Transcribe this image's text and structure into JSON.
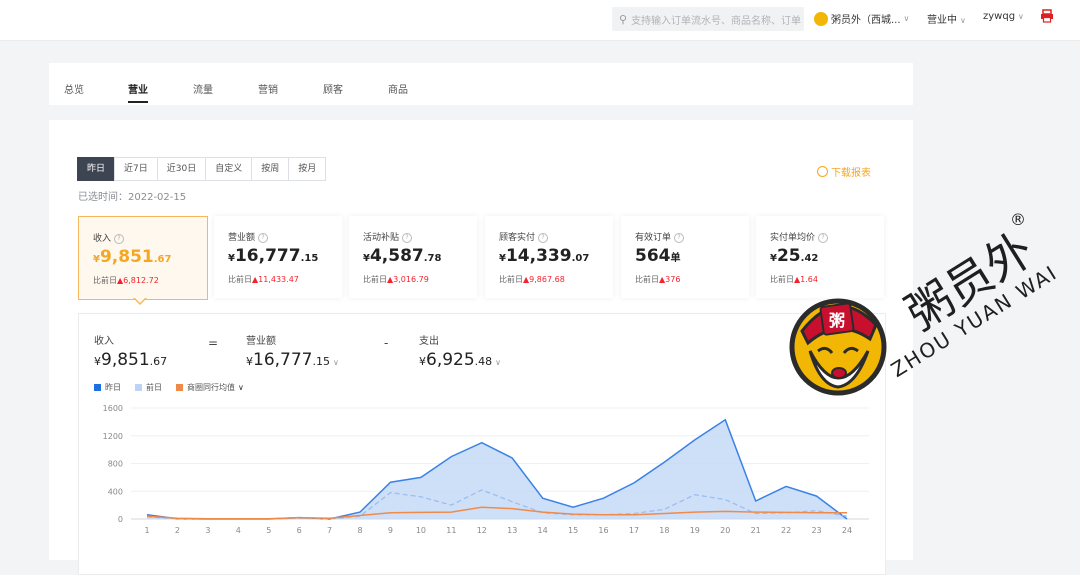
{
  "header": {
    "search_placeholder": "支持输入订单流水号、商品名称、订单",
    "store_name": "粥员外（西城...",
    "status": "营业中",
    "user": "zywqg"
  },
  "tabs": [
    "总览",
    "营业",
    "流量",
    "营销",
    "顾客",
    "商品"
  ],
  "active_tab": "营业",
  "date_ranges": [
    "昨日",
    "近7日",
    "近30日",
    "自定义",
    "按周",
    "按月"
  ],
  "active_range": "昨日",
  "selected_time": "已选时间：2022-02-15",
  "download_label": "下载报表",
  "kpis": [
    {
      "label": "收入",
      "currency": "¥",
      "int": "9,851",
      "dec": ".67",
      "cmp_label": "比前日",
      "cmp_value": "6,812.72"
    },
    {
      "label": "营业额",
      "currency": "¥",
      "int": "16,777",
      "dec": ".15",
      "cmp_label": "比前日",
      "cmp_value": "11,433.47"
    },
    {
      "label": "活动补贴",
      "currency": "¥",
      "int": "4,587",
      "dec": ".78",
      "cmp_label": "比前日",
      "cmp_value": "3,016.79"
    },
    {
      "label": "顾客实付",
      "currency": "¥",
      "int": "14,339",
      "dec": ".07",
      "cmp_label": "比前日",
      "cmp_value": "9,867.68"
    },
    {
      "label": "有效订单",
      "currency": "",
      "int": "564",
      "dec": "单",
      "cmp_label": "比前日",
      "cmp_value": "376"
    },
    {
      "label": "实付单均价",
      "currency": "¥",
      "int": "25",
      "dec": ".42",
      "cmp_label": "比前日",
      "cmp_value": "1.64"
    }
  ],
  "formula": {
    "income_label": "收入",
    "income_cur": "¥",
    "income_int": "9,851",
    "income_dec": ".67",
    "eq": "=",
    "turnover_label": "营业额",
    "turnover_cur": "¥",
    "turnover_int": "16,777",
    "turnover_dec": ".15",
    "minus": "-",
    "expense_label": "支出",
    "expense_cur": "¥",
    "expense_int": "6,925",
    "expense_dec": ".48"
  },
  "colors": {
    "yesterday": "#1e6fe0",
    "day_before": "#bcd3f5",
    "peer": "#f08a4b",
    "accent": "#f5a623",
    "up": "#f5222d"
  },
  "logo": {
    "text_cn": "粥员外",
    "text_en": "ZHOU YUAN WAI",
    "badge": "粥",
    "reg": "®"
  },
  "chart_data": {
    "type": "area",
    "x": [
      "1",
      "2",
      "3",
      "4",
      "5",
      "6",
      "7",
      "8",
      "9",
      "10",
      "11",
      "12",
      "13",
      "14",
      "15",
      "16",
      "17",
      "18",
      "19",
      "20",
      "21",
      "22",
      "23",
      "24"
    ],
    "yticks": [
      "0",
      "400",
      "800",
      "1200",
      "1600"
    ],
    "ylim": [
      0,
      1600
    ],
    "legend": "top-left",
    "series": [
      {
        "name": "昨日",
        "style": "area",
        "values": [
          60,
          5,
          0,
          0,
          0,
          20,
          0,
          100,
          530,
          600,
          900,
          1100,
          880,
          300,
          170,
          300,
          520,
          820,
          1140,
          1430,
          260,
          470,
          330,
          0
        ]
      },
      {
        "name": "前日",
        "style": "dashed",
        "values": [
          30,
          5,
          0,
          0,
          0,
          10,
          0,
          40,
          380,
          320,
          200,
          420,
          250,
          90,
          60,
          60,
          80,
          140,
          350,
          280,
          80,
          90,
          120,
          40
        ]
      },
      {
        "name": "商圈同行均值",
        "style": "line",
        "values": [
          40,
          10,
          5,
          5,
          5,
          20,
          10,
          50,
          90,
          95,
          100,
          170,
          150,
          100,
          70,
          60,
          60,
          80,
          100,
          110,
          100,
          95,
          90,
          90
        ]
      }
    ]
  }
}
